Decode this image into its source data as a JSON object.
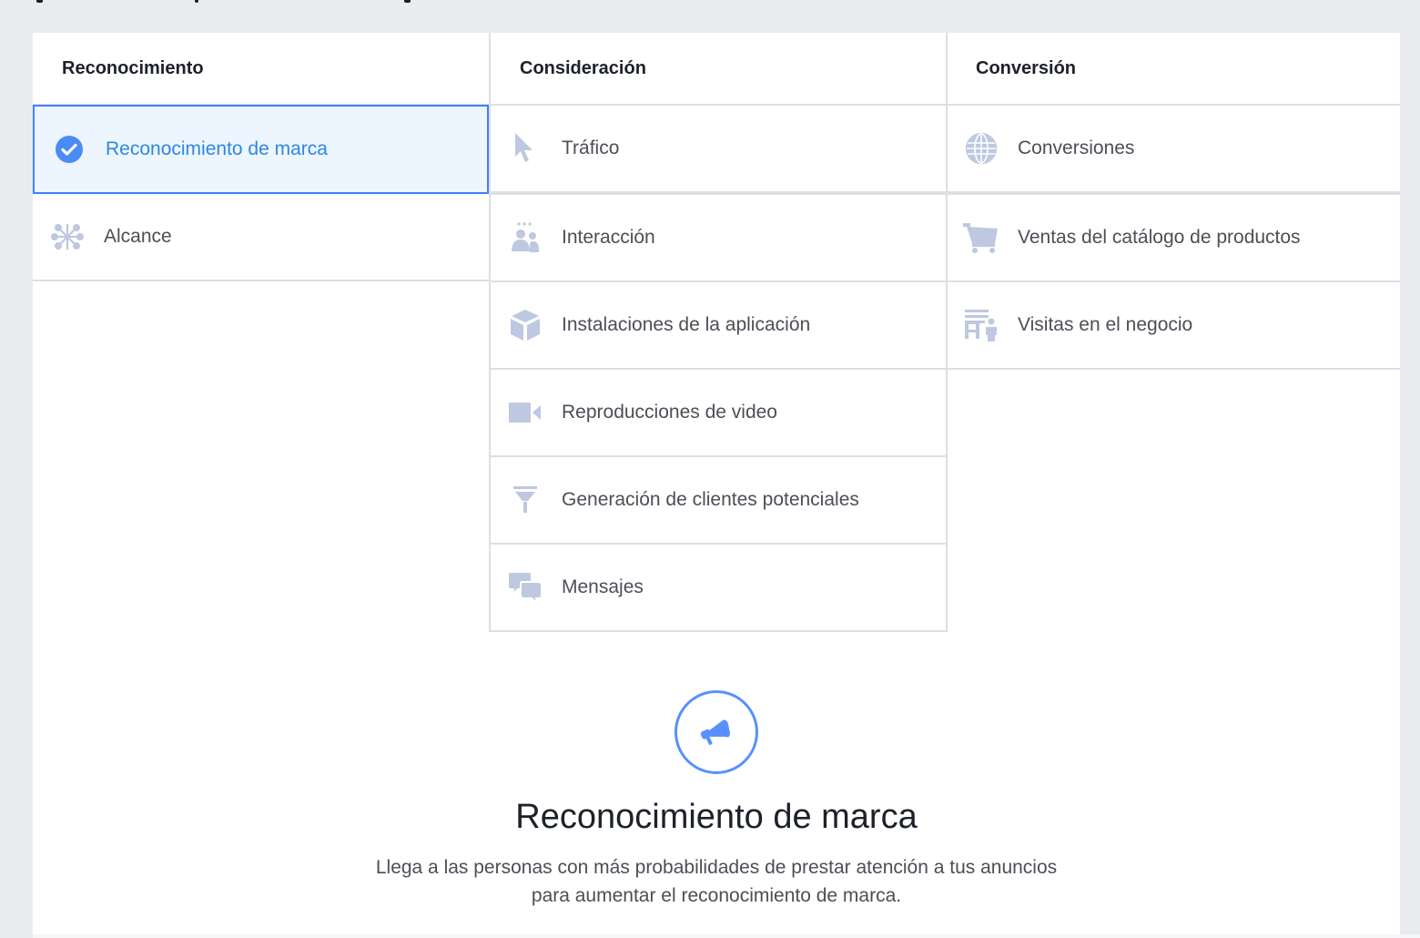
{
  "colors": {
    "page_bg": "#e9ebee",
    "panel_bg": "#ffffff",
    "accent": "#4080ff",
    "selected_bg": "#edf5fe",
    "icon_muted": "#bec8e0",
    "heading_text": "#1d2129",
    "body_text": "#4b4f56"
  },
  "columns": [
    {
      "heading": "Reconocimiento",
      "items": [
        {
          "label": "Reconocimiento de marca",
          "icon": "check-circle-icon",
          "selected": true
        },
        {
          "label": "Alcance",
          "icon": "network-icon",
          "selected": false
        }
      ]
    },
    {
      "heading": "Consideración",
      "items": [
        {
          "label": "Tráfico",
          "icon": "cursor-icon",
          "selected": false
        },
        {
          "label": "Interacción",
          "icon": "people-icon",
          "selected": false
        },
        {
          "label": "Instalaciones de la aplicación",
          "icon": "cube-icon",
          "selected": false
        },
        {
          "label": "Reproducciones de video",
          "icon": "video-camera-icon",
          "selected": false
        },
        {
          "label": "Generación de clientes potenciales",
          "icon": "funnel-icon",
          "selected": false
        },
        {
          "label": "Mensajes",
          "icon": "chat-bubbles-icon",
          "selected": false
        }
      ]
    },
    {
      "heading": "Conversión",
      "items": [
        {
          "label": "Conversiones",
          "icon": "globe-icon",
          "selected": false
        },
        {
          "label": "Ventas del catálogo de productos",
          "icon": "shopping-cart-icon",
          "selected": false
        },
        {
          "label": "Visitas en el negocio",
          "icon": "store-visit-icon",
          "selected": false
        }
      ]
    }
  ],
  "detail": {
    "icon": "megaphone-icon",
    "title": "Reconocimiento de marca",
    "description": "Llega a las personas con más probabilidades de prestar atención a tus anuncios para aumentar el reconocimiento de marca."
  }
}
